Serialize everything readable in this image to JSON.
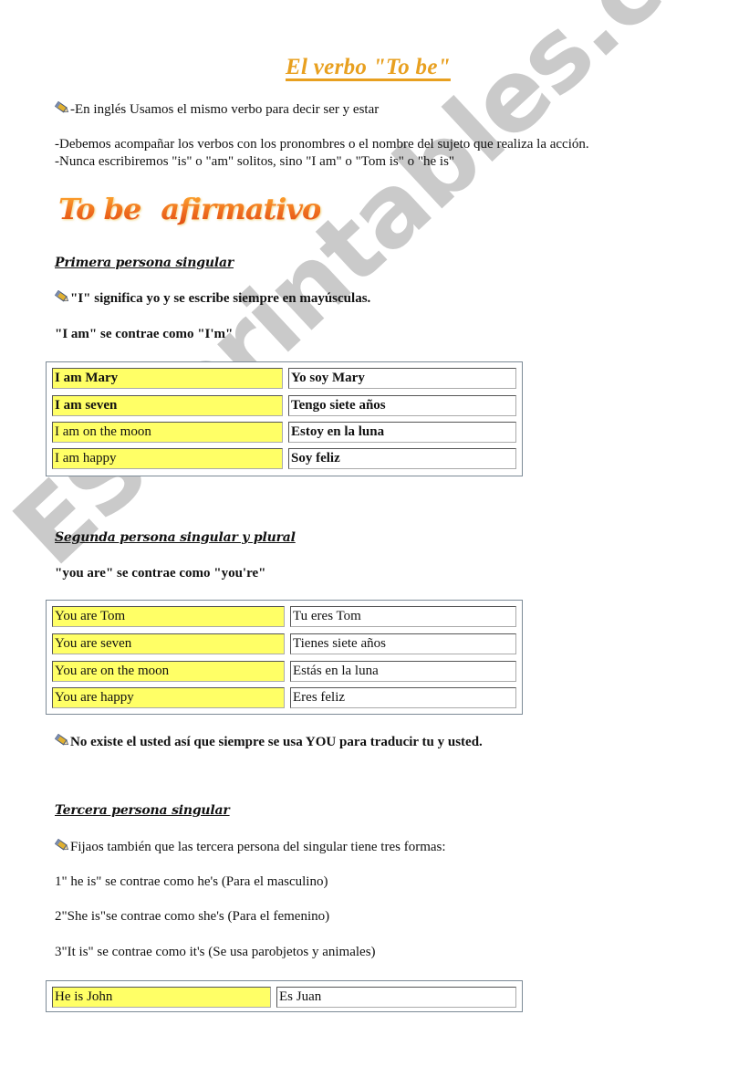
{
  "document": {
    "title": "El verbo \"To be\"",
    "intro": {
      "line1": "-En inglés Usamos el mismo verbo para decir ser y estar",
      "line2": "-Debemos acompañar los verbos con los pronombres o el nombre del sujeto que realiza la acción.",
      "line3": "-Nunca escribiremos \"is\" o \"am\" solitos, sino \"I am\" o \"Tom is\" o \"he is\""
    },
    "banner": {
      "word1": "To be",
      "word2": "afirmativo"
    },
    "sections": [
      {
        "heading": "Primera persona singular",
        "note": "\"I\" significa yo y se escribe siempre en mayúsculas.",
        "contraction": "\"I am\" se contrae como \"I'm\"",
        "rows": [
          {
            "en": "I am Mary",
            "es": "Yo soy Mary"
          },
          {
            "en": "I am seven",
            "es": "Tengo siete años"
          },
          {
            "en": "I am on the moon",
            "es": "Estoy en la luna"
          },
          {
            "en": "I am happy",
            "es": "Soy feliz"
          }
        ]
      },
      {
        "heading": "Segunda persona singular y plural",
        "contraction": "\"you are\" se contrae como \"you're\"",
        "rows": [
          {
            "en": "You are Tom",
            "es": "Tu eres Tom"
          },
          {
            "en": "You are seven",
            "es": "Tienes siete años"
          },
          {
            "en": "You are on the moon",
            "es": "Estás en la luna"
          },
          {
            "en": "You are happy",
            "es": "Eres feliz"
          }
        ],
        "note": "No existe el usted así que siempre se usa YOU para traducir tu y usted."
      },
      {
        "heading": "Tercera persona singular",
        "note": "Fijaos también que las tercera persona del singular tiene tres formas:",
        "forms": [
          "1\" he is\" se contrae como he's (Para el masculino)",
          "2\"She is\"se contrae como she's (Para el femenino)",
          "3\"It is\" se contrae como it's (Se usa parobjetos y animales)"
        ],
        "rows": [
          {
            "en": "He is John",
            "es": "Es Juan"
          }
        ]
      }
    ],
    "watermark": "ESLprintables.com",
    "colors": {
      "title": "#e8a020",
      "highlight": "#ffff66",
      "watermark": "#969696"
    }
  }
}
